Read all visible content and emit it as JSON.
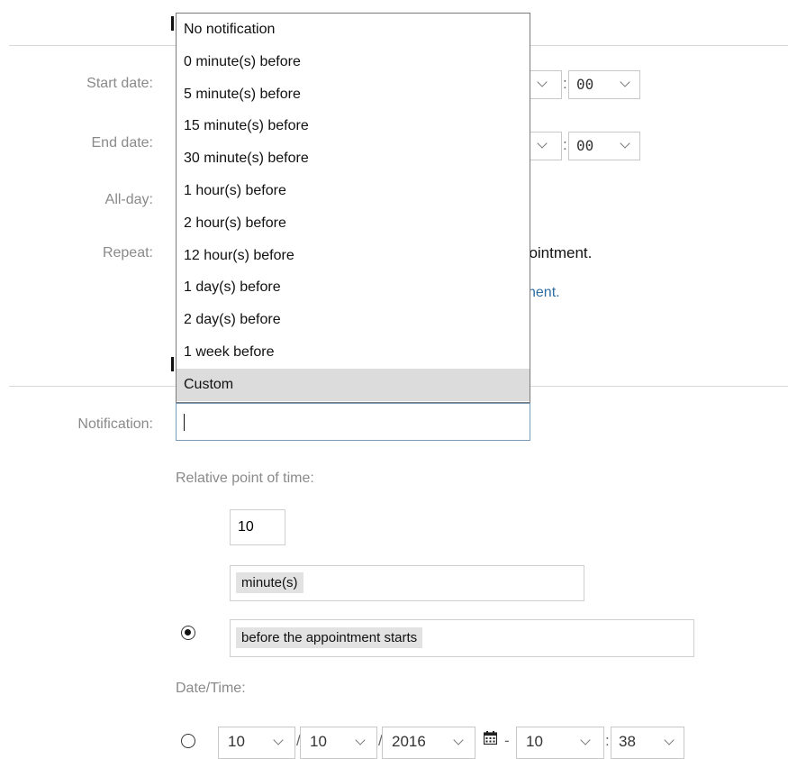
{
  "labels": {
    "start_date": "Start date:",
    "end_date": "End date:",
    "all_day": "All-day:",
    "repeat": "Repeat:",
    "notification": "Notification:"
  },
  "start_time": {
    "minute": "00"
  },
  "end_time": {
    "minute": "00"
  },
  "repeat_text": "pointment.",
  "repeat_link": "nent.",
  "notification_dropdown": {
    "options": [
      "No notification",
      "0 minute(s) before",
      "5 minute(s) before",
      "15 minute(s) before",
      "30 minute(s) before",
      "1 hour(s) before",
      "2 hour(s) before",
      "12 hour(s) before",
      "1 day(s) before",
      "2 day(s) before",
      "1 week before",
      "Custom"
    ],
    "highlighted": "Custom"
  },
  "notification_input": {
    "value": ""
  },
  "relative": {
    "heading": "Relative point of time:",
    "amount": "10",
    "unit": "minute(s)",
    "anchor": "before the appointment starts"
  },
  "datetime": {
    "heading": "Date/Time:",
    "day": "10",
    "month": "10",
    "year": "2016",
    "dash": "-",
    "hour": "10",
    "minute": "38"
  },
  "colors": {
    "label_gray": "#8a8a8a",
    "link_blue": "#2e6da4",
    "highlight": "#dcdcdc",
    "focus_border": "#7a9ab8"
  }
}
